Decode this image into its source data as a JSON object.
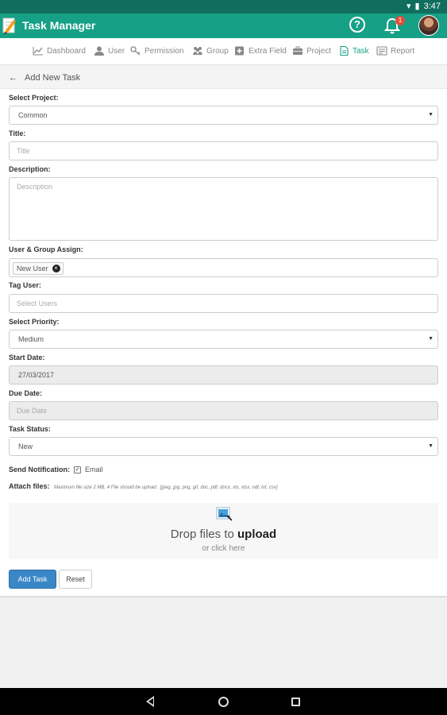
{
  "status_bar": {
    "time": "3:47"
  },
  "app_bar": {
    "title": "Task Manager",
    "help_symbol": "?",
    "notification_count": "1"
  },
  "nav": {
    "items": [
      {
        "label": "Dashboard",
        "icon": "chart-line-icon"
      },
      {
        "label": "User",
        "icon": "user-icon"
      },
      {
        "label": "Permission",
        "icon": "key-icon"
      },
      {
        "label": "Group",
        "icon": "group-icon"
      },
      {
        "label": "Extra Field",
        "icon": "plus-square-icon"
      },
      {
        "label": "Project",
        "icon": "briefcase-icon"
      },
      {
        "label": "Task",
        "icon": "file-icon",
        "active": true
      },
      {
        "label": "Report",
        "icon": "report-icon"
      }
    ]
  },
  "page": {
    "title": "Add New Task"
  },
  "form": {
    "project_label": "Select Project:",
    "project_value": "Common",
    "title_label": "Title:",
    "title_placeholder": "Title",
    "description_label": "Description:",
    "description_placeholder": "Description",
    "assign_label": "User & Group Assign:",
    "assign_chip": "New User",
    "tag_label": "Tag User:",
    "tag_placeholder": "Select Users",
    "priority_label": "Select Priority:",
    "priority_value": "Medium",
    "start_label": "Start Date:",
    "start_value": "27/03/2017",
    "due_label": "Due Date:",
    "due_placeholder": "Due Date",
    "status_label": "Task Status:",
    "status_value": "New",
    "notification_label": "Send Notification:",
    "notification_option": "Email",
    "notification_checked": true,
    "attach_label": "Attach files:",
    "attach_note": "Maximum file size 2 MB, 4 File should be upload . [jpeg, jpg, png, gif, doc, pdf, docx, xls, xlsx, odt, txt, csv]",
    "dropzone_text": "Drop files to",
    "dropzone_bold": "upload",
    "dropzone_sub": "or click here",
    "submit_label": "Add Task",
    "reset_label": "Reset"
  },
  "colors": {
    "primary": "#16a085",
    "status_bar": "#0f6e5d",
    "button_primary": "#3a87c7",
    "badge": "#e74c3c"
  }
}
